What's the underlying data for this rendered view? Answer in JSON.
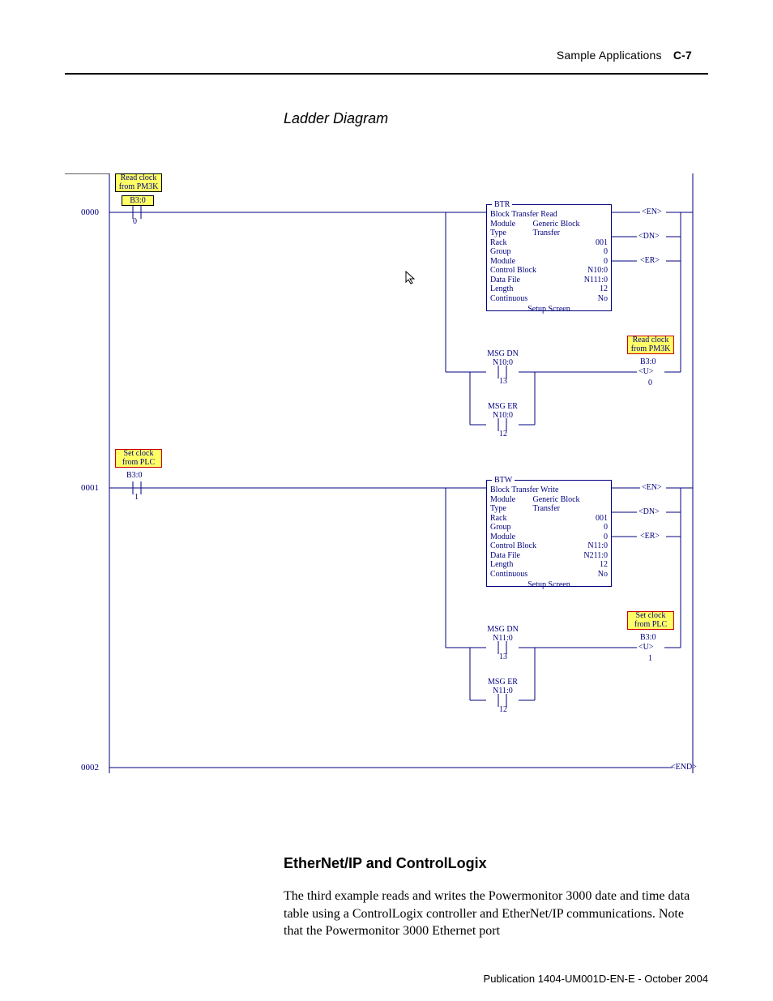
{
  "header": {
    "breadcrumb": "Sample Applications",
    "page_number": "C-7"
  },
  "section_title": "Ladder Diagram",
  "heading": "EtherNet/IP and ControlLogix",
  "paragraph": "The third example reads and writes the Powermonitor 3000 date and time data table using a ControlLogix controller and EtherNet/IP communications. Note that the Powermonitor 3000 Ethernet port",
  "publication": "Publication 1404-UM001D-EN-E - October 2004",
  "rungs": {
    "r0": {
      "num": "0000",
      "tag": {
        "l1": "Read clock",
        "l2": "from PM3K"
      },
      "addr": "B3:0",
      "bit": "0",
      "box": {
        "code": "BTR",
        "title": "Block Transfer Read",
        "rows": [
          [
            "Module Type",
            "Generic Block Transfer"
          ],
          [
            "Rack",
            "001"
          ],
          [
            "Group",
            "0"
          ],
          [
            "Module",
            "0"
          ],
          [
            "Control Block",
            "N10:0"
          ],
          [
            "Data File",
            "N111:0"
          ],
          [
            "Length",
            "12"
          ],
          [
            "Continuous",
            "No"
          ]
        ],
        "setup": "Setup Screen"
      },
      "status": {
        "en": "EN",
        "dn": "DN",
        "er": "ER"
      },
      "branch": {
        "dn": {
          "t": "MSG DN",
          "a": "N10:0",
          "b": "13"
        },
        "er": {
          "t": "MSG ER",
          "a": "N10:0",
          "b": "12"
        },
        "out": {
          "l1": "Read clock",
          "l2": "from PM3K",
          "a": "B3:0",
          "coil": "U",
          "b": "0"
        }
      }
    },
    "r1": {
      "num": "0001",
      "tag": {
        "l1": "Set clock",
        "l2": "from PLC"
      },
      "addr": "B3:0",
      "bit": "1",
      "box": {
        "code": "BTW",
        "title": "Block Transfer Write",
        "rows": [
          [
            "Module Type",
            "Generic Block Transfer"
          ],
          [
            "Rack",
            "001"
          ],
          [
            "Group",
            "0"
          ],
          [
            "Module",
            "0"
          ],
          [
            "Control Block",
            "N11:0"
          ],
          [
            "Data File",
            "N211:0"
          ],
          [
            "Length",
            "12"
          ],
          [
            "Continuous",
            "No"
          ]
        ],
        "setup": "Setup Screen"
      },
      "status": {
        "en": "EN",
        "dn": "DN",
        "er": "ER"
      },
      "branch": {
        "dn": {
          "t": "MSG DN",
          "a": "N11:0",
          "b": "13"
        },
        "er": {
          "t": "MSG ER",
          "a": "N11:0",
          "b": "12"
        },
        "out": {
          "l1": "Set clock",
          "l2": "from PLC",
          "a": "B3:0",
          "coil": "U",
          "b": "1"
        }
      }
    },
    "r2": {
      "num": "0002",
      "end": "END"
    }
  }
}
